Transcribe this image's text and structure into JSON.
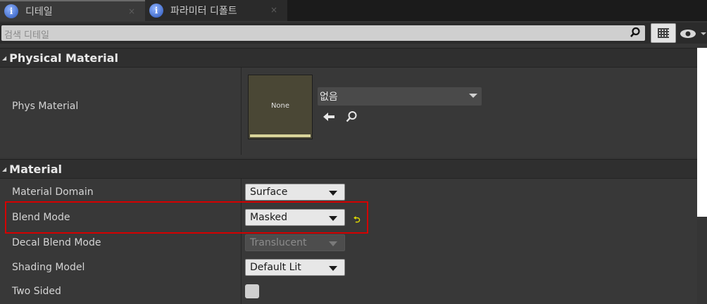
{
  "tabs": [
    {
      "label": "디테일",
      "close": "×"
    },
    {
      "label": "파라미터 디폴트",
      "close": "×"
    }
  ],
  "search": {
    "placeholder": "검색 디테일"
  },
  "sections": {
    "physical_material": {
      "title": "Physical Material",
      "phys_material_label": "Phys Material",
      "thumbnail_text": "None",
      "asset_value": "없음"
    },
    "material": {
      "title": "Material",
      "rows": [
        {
          "label": "Material Domain",
          "value": "Surface"
        },
        {
          "label": "Blend Mode",
          "value": "Masked",
          "reset_icon": "reset-to-default-icon"
        },
        {
          "label": "Decal Blend Mode",
          "value": "Translucent",
          "disabled": true
        },
        {
          "label": "Shading Model",
          "value": "Default Lit"
        },
        {
          "label": "Two Sided",
          "checked": false
        }
      ]
    }
  },
  "colors": {
    "highlight": "#d40000",
    "reset": "#e5e000"
  }
}
